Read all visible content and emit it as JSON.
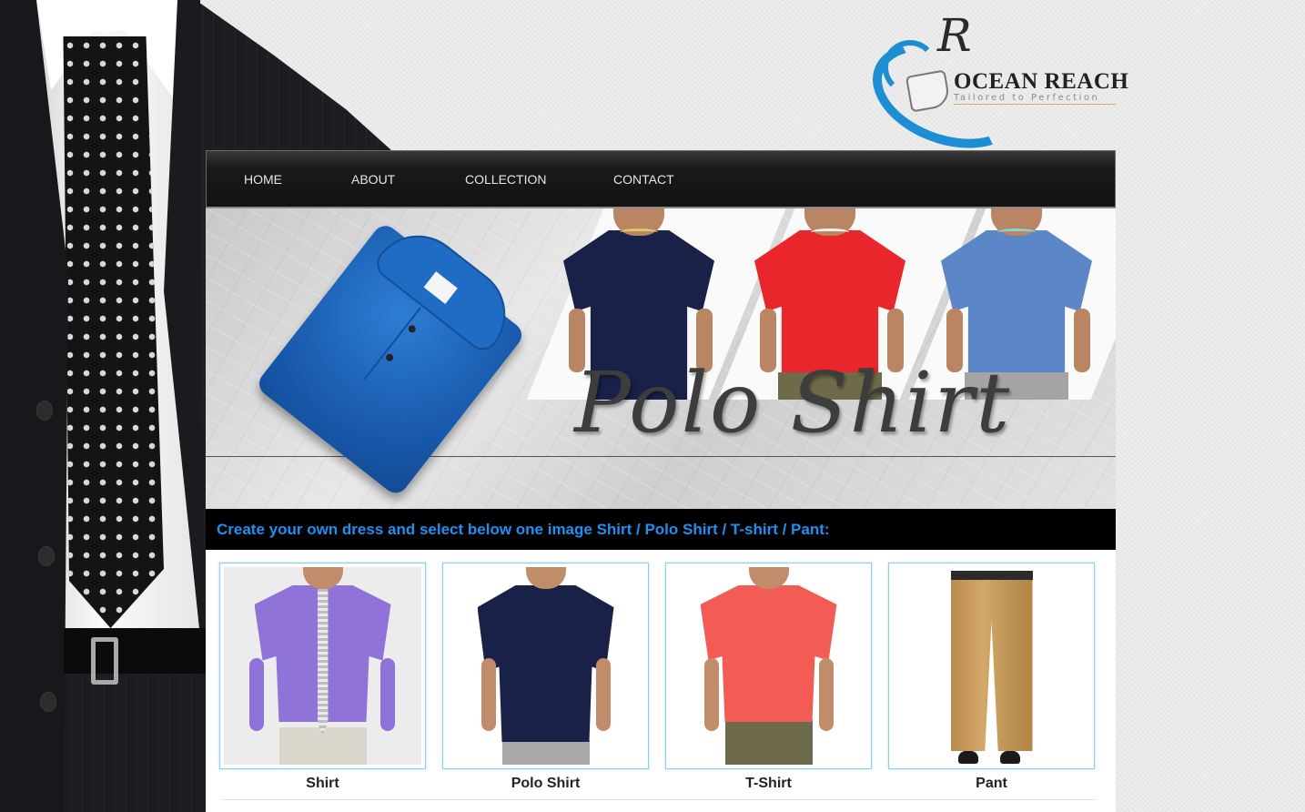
{
  "brand": {
    "logo_letter": "R",
    "name": "OCEAN REACH",
    "tagline": "Tailored to Perfection",
    "accent_color": "#1c8fd4"
  },
  "nav": {
    "items": [
      {
        "label": "HOME"
      },
      {
        "label": "ABOUT"
      },
      {
        "label": "COLLECTION"
      },
      {
        "label": "CONTACT"
      }
    ]
  },
  "banner": {
    "title": "Polo Shirt",
    "models": [
      {
        "shirt_color": "#1a2148"
      },
      {
        "shirt_color": "#e8262b"
      },
      {
        "shirt_color": "#5b86c7"
      }
    ],
    "folded_shirt_color": "#1a5cb0"
  },
  "instruction": {
    "text": "Create your own dress and select below one image Shirt / Polo Shirt / T-shirt / Pant:",
    "text_color": "#1e90f0"
  },
  "products": [
    {
      "label": "Shirt",
      "icon": "shirt-photo",
      "color": "#8f73d8"
    },
    {
      "label": "Polo Shirt",
      "icon": "polo-shirt-photo",
      "color": "#1a2148"
    },
    {
      "label": "T-Shirt",
      "icon": "t-shirt-photo",
      "color": "#f25c54"
    },
    {
      "label": "Pant",
      "icon": "pant-photo",
      "color": "#c99d5d"
    }
  ]
}
